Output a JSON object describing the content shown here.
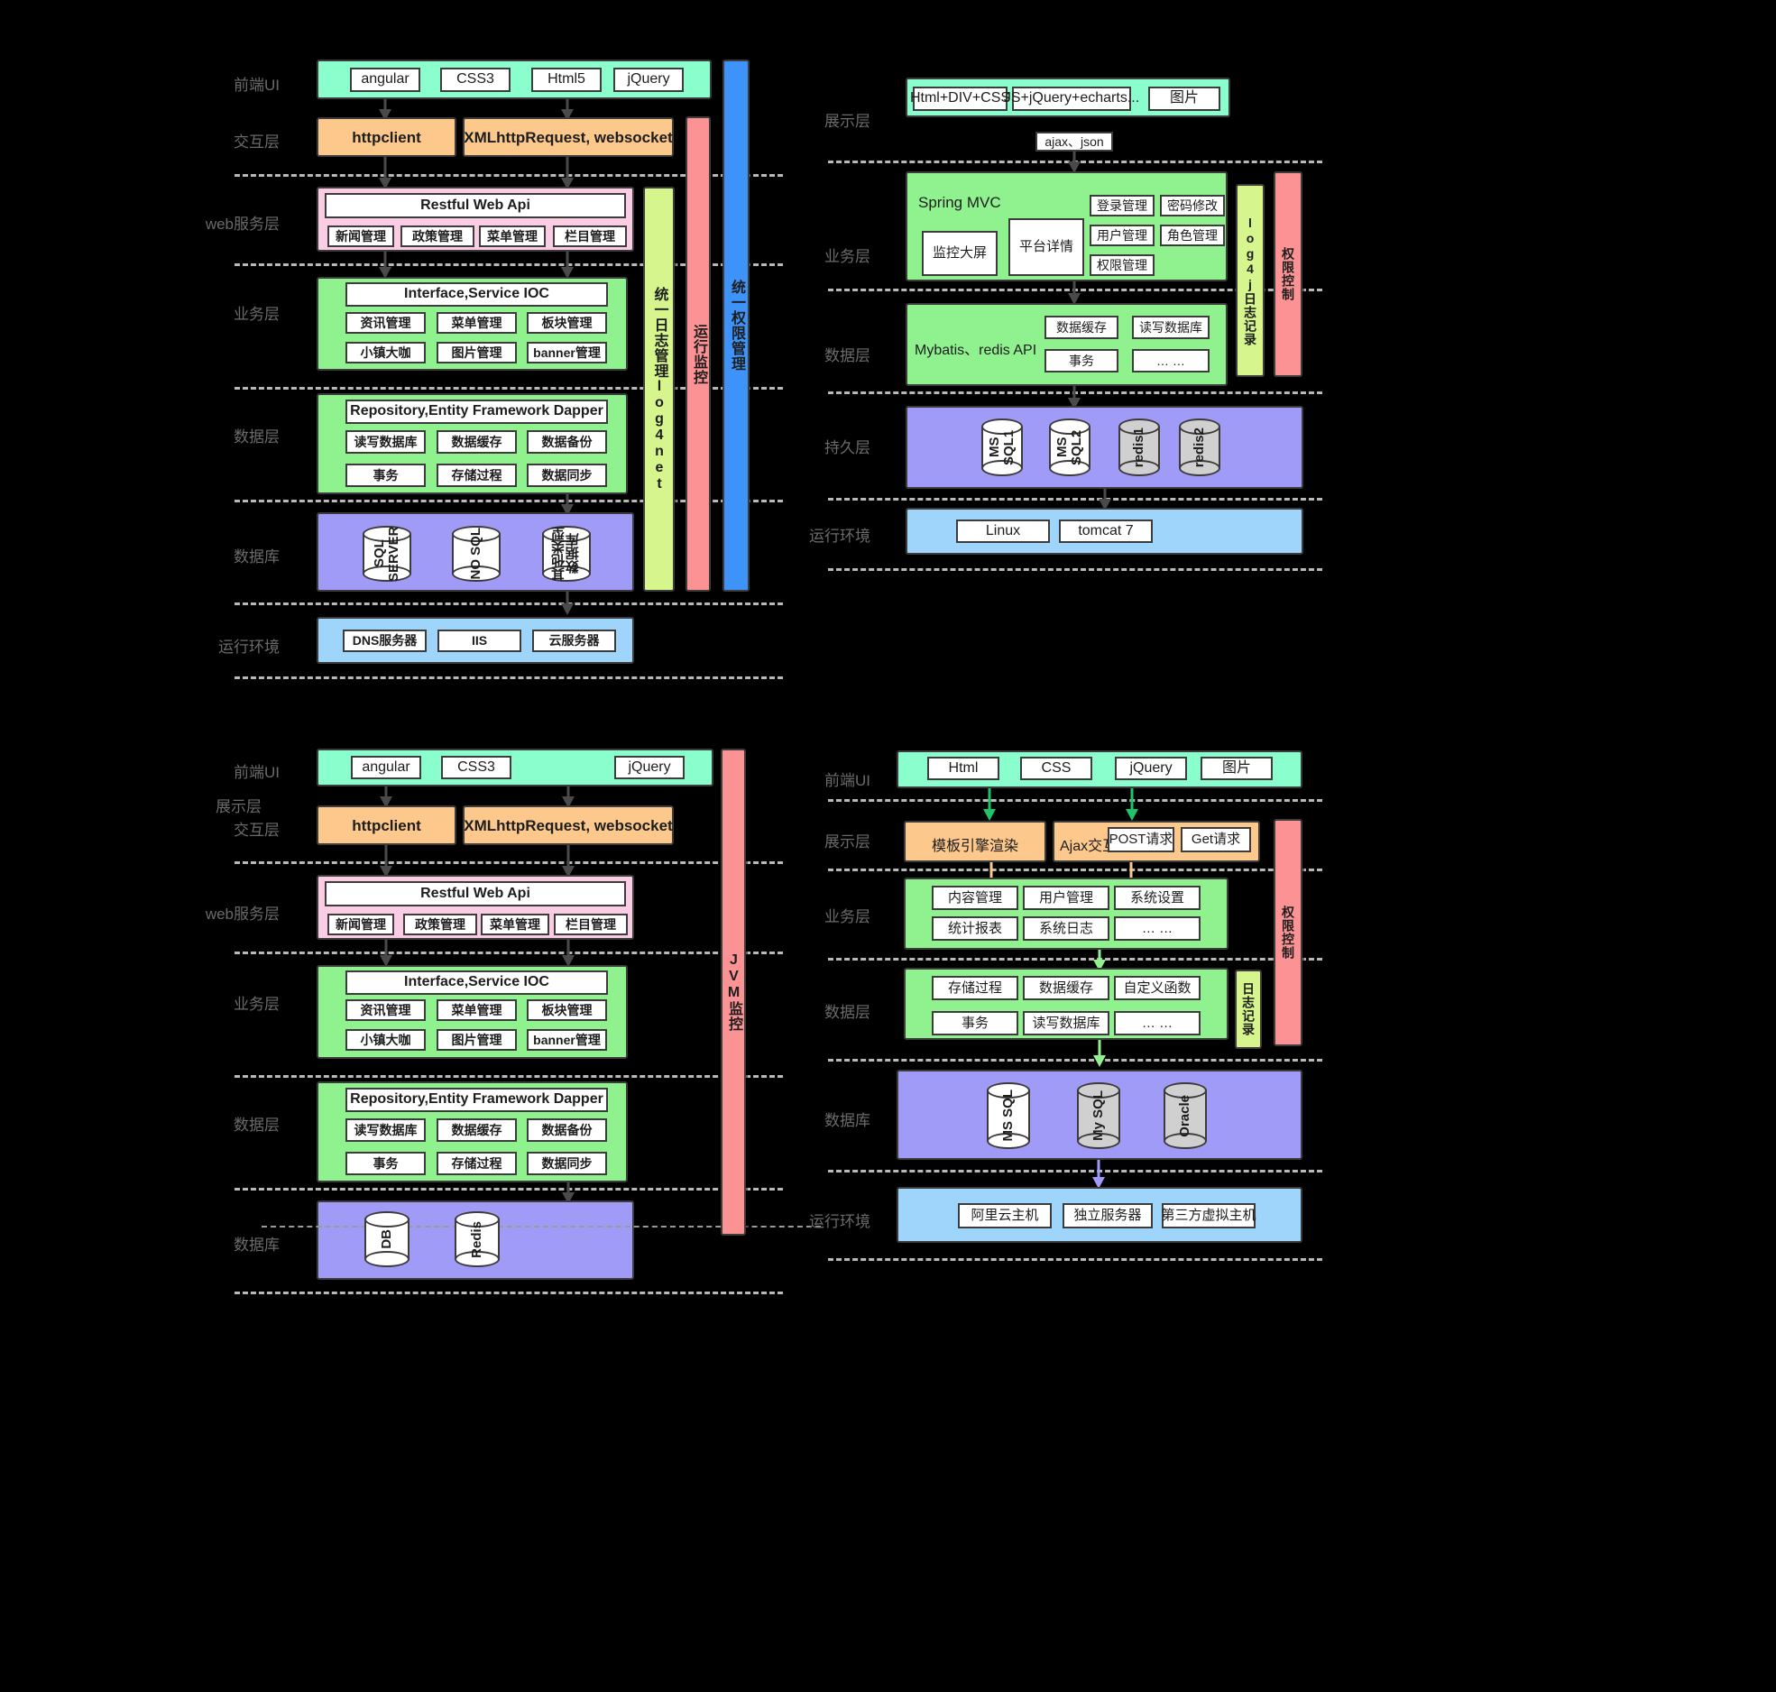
{
  "diagrams": {
    "topleft": {
      "layer_labels": {
        "ui": "前端UI",
        "interaction": "交互层",
        "web": "web服务层",
        "business": "业务层",
        "data": "数据层",
        "database": "数据库",
        "runtime": "运行环境"
      },
      "ui_row": [
        "angular",
        "CSS3",
        "Html5",
        "jQuery"
      ],
      "interaction_row": [
        "httpclient",
        "XMLhttpRequest, websocket"
      ],
      "web": {
        "title": "Restful Web Api",
        "items": [
          "新闻管理",
          "政策管理",
          "菜单管理",
          "栏目管理"
        ]
      },
      "business": {
        "title": "Interface,Service IOC",
        "items": [
          "资讯管理",
          "菜单管理",
          "板块管理",
          "小镇大咖",
          "图片管理",
          "banner管理"
        ]
      },
      "data": {
        "title": "Repository,Entity Framework Dapper",
        "items": [
          "读写数据库",
          "数据缓存",
          "数据备份",
          "事务",
          "存储过程",
          "数据同步"
        ]
      },
      "database_cylinders": [
        "SQL SERVER",
        "NO SQL",
        "其他类型数据库"
      ],
      "runtime_row": [
        "DNS服务器",
        "IIS",
        "云服务器"
      ],
      "vbars": [
        {
          "text": "统一日志管理log4net",
          "color": "#d6f58d"
        },
        {
          "text": "运行监控",
          "color": "#fb9293"
        },
        {
          "text": "统一权限管理",
          "color": "#3d93f7"
        }
      ]
    },
    "topright": {
      "layer_labels": {
        "presentation": "展示层",
        "business": "业务层",
        "data": "数据层",
        "persistence": "持久层",
        "runtime": "运行环境"
      },
      "presentation_row": [
        "Html+DIV+CSS",
        "JS+jQuery+echarts...",
        "图片"
      ],
      "connector_label": "ajax、json",
      "business": {
        "framework": "Spring MVC",
        "big": "监控大屏",
        "detail": "平台详情",
        "items": [
          "登录管理",
          "密码修改",
          "用户管理",
          "角色管理",
          "权限管理"
        ]
      },
      "data": {
        "framework": "Mybatis、redis API",
        "items": [
          "数据缓存",
          "读写数据库",
          "事务",
          "… …"
        ]
      },
      "persistence_cylinders": [
        "MS SQL1",
        "MS SQL2",
        "redis1",
        "redis2"
      ],
      "runtime_row": [
        "Linux",
        "tomcat 7"
      ],
      "vbars": [
        {
          "text": "log4j日志记录",
          "color": "#d6f58d"
        },
        {
          "text": "权限控制",
          "color": "#fb9293"
        }
      ]
    },
    "bottomleft": {
      "layer_labels": {
        "ui": "前端UI",
        "presentation": "展示层",
        "interaction": "交互层",
        "web": "web服务层",
        "business": "业务层",
        "data": "数据层",
        "database": "数据库"
      },
      "ui_row": [
        "angular",
        "CSS3",
        "jQuery"
      ],
      "interaction_row": [
        "httpclient",
        "XMLhttpRequest, websocket"
      ],
      "web": {
        "title": "Restful Web Api",
        "items": [
          "新闻管理",
          "政策管理",
          "菜单管理",
          "栏目管理"
        ]
      },
      "business": {
        "title": "Interface,Service IOC",
        "items": [
          "资讯管理",
          "菜单管理",
          "板块管理",
          "小镇大咖",
          "图片管理",
          "banner管理"
        ]
      },
      "data": {
        "title": "Repository,Entity Framework Dapper",
        "items": [
          "读写数据库",
          "数据缓存",
          "数据备份",
          "事务",
          "存储过程",
          "数据同步"
        ]
      },
      "database_cylinders": [
        "DB",
        "Redis"
      ],
      "vbars": [
        {
          "text": "JVM监控",
          "color": "#fb9293"
        }
      ]
    },
    "bottomright": {
      "layer_labels": {
        "ui": "前端UI",
        "presentation": "展示层",
        "business": "业务层",
        "data": "数据层",
        "database": "数据库",
        "runtime": "运行环境"
      },
      "ui_row": [
        "Html",
        "CSS",
        "jQuery",
        "图片"
      ],
      "presentation": {
        "template": "模板引擎渲染",
        "ajax_label": "Ajax交互",
        "requests": [
          "POST请求",
          "Get请求"
        ]
      },
      "business_items": [
        "内容管理",
        "用户管理",
        "系统设置",
        "统计报表",
        "系统日志",
        "… …"
      ],
      "data_items": [
        "存储过程",
        "数据缓存",
        "自定义函数",
        "事务",
        "读写数据库",
        "… …"
      ],
      "database_cylinders": [
        "MS SQL",
        "My SQL",
        "Oracle"
      ],
      "runtime_row": [
        "阿里云主机",
        "独立服务器",
        "第三方虚拟主机"
      ],
      "vbars": [
        {
          "text": "日志记录",
          "color": "#d6f58d"
        },
        {
          "text": "权限控制",
          "color": "#fb9293"
        }
      ]
    }
  }
}
